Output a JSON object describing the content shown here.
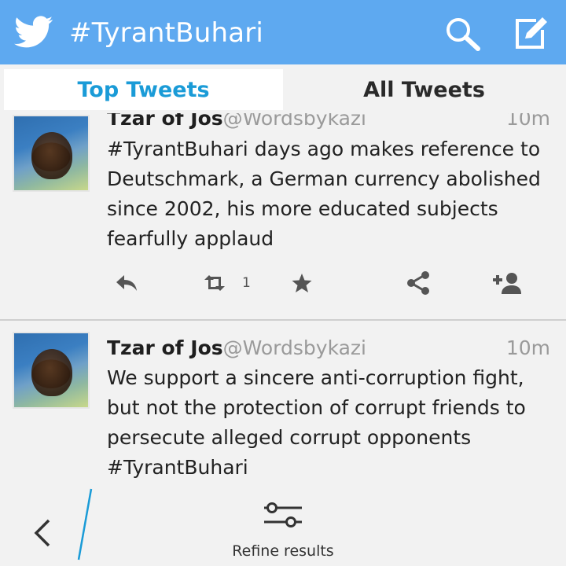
{
  "header": {
    "title": "#TyrantBuhari",
    "icons": {
      "logo": "twitter-bird-icon",
      "search": "search-icon",
      "compose": "compose-icon"
    }
  },
  "tabs": [
    {
      "label": "Top Tweets",
      "selected": true
    },
    {
      "label": "All Tweets",
      "selected": false
    }
  ],
  "tweets": [
    {
      "name": "Tzar of Jos",
      "handle": "@Wordsbykazi",
      "time": "10m",
      "text": "#TyrantBuhari days ago makes reference to Deutschmark, a German currency abolished since 2002, his more educated subjects fearfully applaud",
      "retweet_count": "1"
    },
    {
      "name": "Tzar of Jos",
      "handle": "@Wordsbykazi",
      "time": "10m",
      "text": "We support a sincere anti-corruption fight, but not the protection of corrupt friends to persecute alleged corrupt opponents #TyrantBuhari"
    }
  ],
  "bottom_bar": {
    "refine_label": "Refine results"
  },
  "colors": {
    "header_bg": "#5ea9f0",
    "accent": "#1a9bd7"
  }
}
